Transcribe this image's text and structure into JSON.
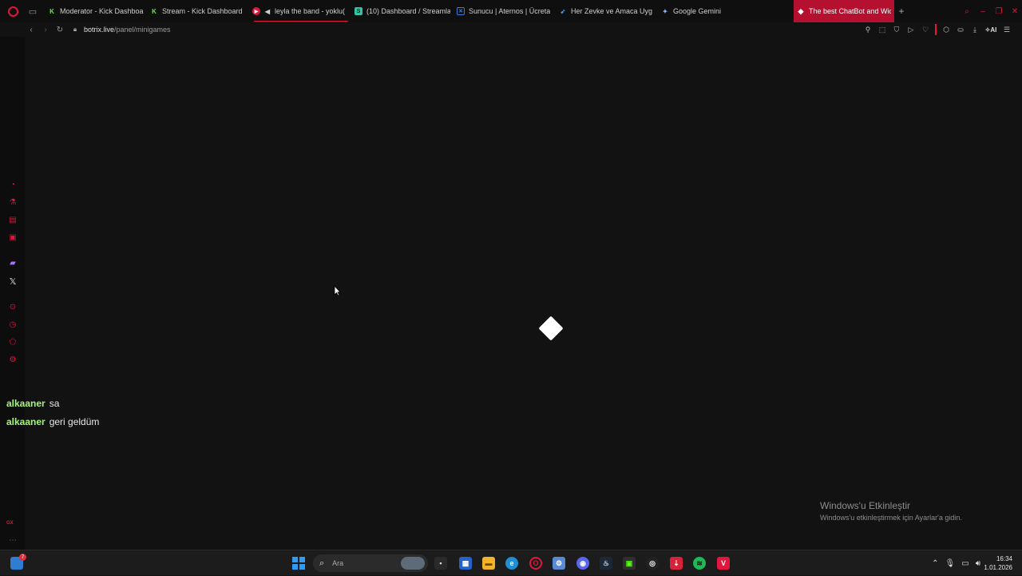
{
  "tabs": [
    {
      "title": "Moderator - Kick Dashboa",
      "icon": "kick-icon",
      "color": "#53fc18"
    },
    {
      "title": "Stream - Kick Dashboard",
      "icon": "kick-icon",
      "color": "#53fc18"
    },
    {
      "title": "leyla the band - yoklu(",
      "icon": "youtube-icon",
      "color": "#e0163c",
      "playing": true
    },
    {
      "title": "(10) Dashboard / Streamla",
      "icon": "streamlabs-icon",
      "color": "#31c3a2"
    },
    {
      "title": "Sunucu | Aternos | Ücreta",
      "icon": "aternos-icon",
      "color": "#3b7dd8"
    },
    {
      "title": "Her Zevke ve Amaca Uyg",
      "icon": "bird-icon",
      "color": "#4aa3f0"
    },
    {
      "title": "Google Gemini",
      "icon": "gemini-icon",
      "color": "#8ab4f8"
    },
    {
      "title": "The best ChatBot and Wid",
      "icon": "botrix-icon",
      "color": "#ffffff",
      "active": true
    }
  ],
  "address": {
    "domain": "botrix.live",
    "path": "/panel/minigames"
  },
  "toolbar_right": {
    "ai_label": "AI"
  },
  "chat": [
    {
      "user": "alkaaner",
      "message": "sa"
    },
    {
      "user": "alkaaner",
      "message": "geri geldüm"
    }
  ],
  "watermark": {
    "title": "Windows'u Etkinleştir",
    "subtitle": "Windows'u etkinleştirmek için Ayarlar'a gidin."
  },
  "taskbar": {
    "search_placeholder": "Ara",
    "widget_badge": "7",
    "time": "16:34",
    "date": "1.01.2026"
  },
  "sidebar": {
    "gx_label": "GX"
  },
  "colors": {
    "accent": "#e0163c",
    "chat_user": "#a6f47a",
    "background": "#121212"
  }
}
